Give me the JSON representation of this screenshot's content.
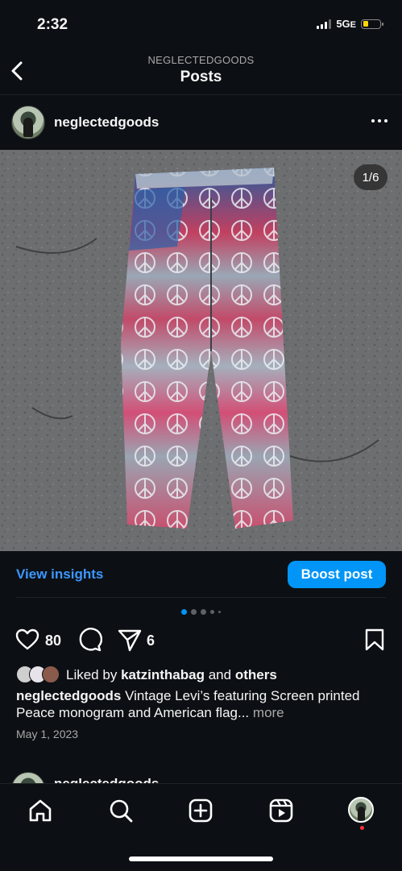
{
  "status": {
    "time": "2:32",
    "network": "5G",
    "network_suffix": "E"
  },
  "header": {
    "subtitle": "NEGLECTEDGOODS",
    "title": "Posts"
  },
  "post": {
    "username": "neglectedgoods",
    "counter": "1/6",
    "insights_label": "View insights",
    "boost_label": "Boost post",
    "likes": "80",
    "shares": "6",
    "liked_by_prefix": "Liked by",
    "liked_by_user": "katzinthabag",
    "liked_by_and": "and",
    "liked_by_others": "others",
    "caption_username": "neglectedgoods",
    "caption_text": "Vintage Levi’s featuring Screen printed Peace monogram and American flag...",
    "caption_more": "more",
    "date": "May 1, 2023",
    "carousel_total": 6,
    "carousel_index": 1
  },
  "next_post": {
    "username": "neglectedgoods"
  },
  "nav": {
    "items": [
      {
        "name": "home",
        "icon": "home-icon"
      },
      {
        "name": "search",
        "icon": "search-icon"
      },
      {
        "name": "create",
        "icon": "plus-square-icon"
      },
      {
        "name": "reels",
        "icon": "reels-icon"
      },
      {
        "name": "profile",
        "icon": "profile-avatar"
      }
    ]
  },
  "colors": {
    "accent": "#0095f6",
    "link": "#3d97ff",
    "background": "#0c1014",
    "notification": "#ff3040",
    "battery": "#ffd60a"
  }
}
